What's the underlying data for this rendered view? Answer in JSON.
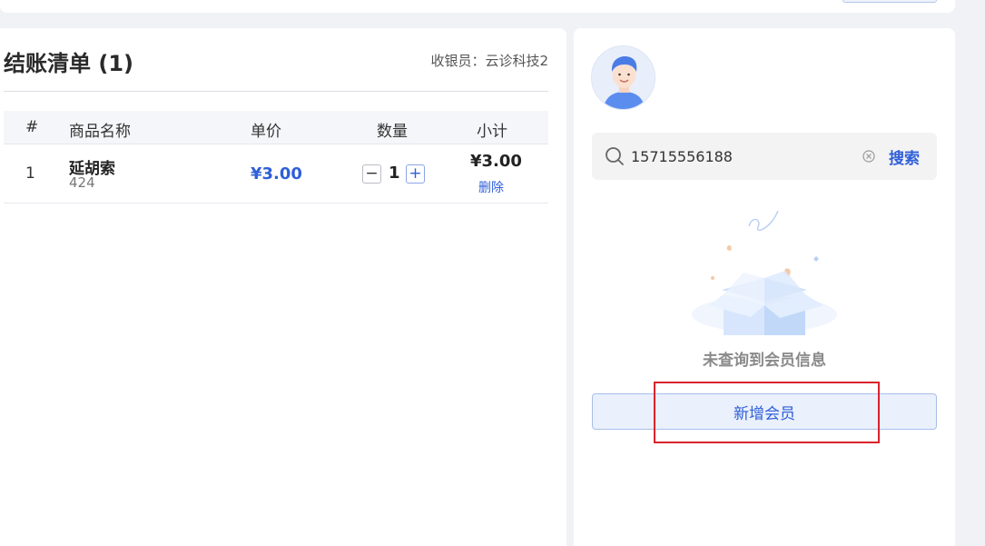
{
  "checkout": {
    "title": "结账清单 (1)",
    "cashier_label": "收银员：云诊科技2"
  },
  "table": {
    "headers": [
      "#",
      "商品名称",
      "单价",
      "数量",
      "小计"
    ],
    "rows": [
      {
        "index": "1",
        "name": "延胡索",
        "code": "424",
        "price": "¥3.00",
        "qty": "1",
        "subtotal": "¥3.00",
        "delete_label": "删除"
      }
    ]
  },
  "member": {
    "search_value": "15715556188",
    "search_button": "搜索",
    "empty_text": "未查询到会员信息",
    "add_button": "新增会员"
  },
  "colors": {
    "accent": "#2f5fd8",
    "highlight": "#d9232d"
  },
  "icons": {
    "search": "search-icon",
    "clear": "clear-icon",
    "avatar": "user-avatar",
    "empty": "empty-box-illustration"
  }
}
